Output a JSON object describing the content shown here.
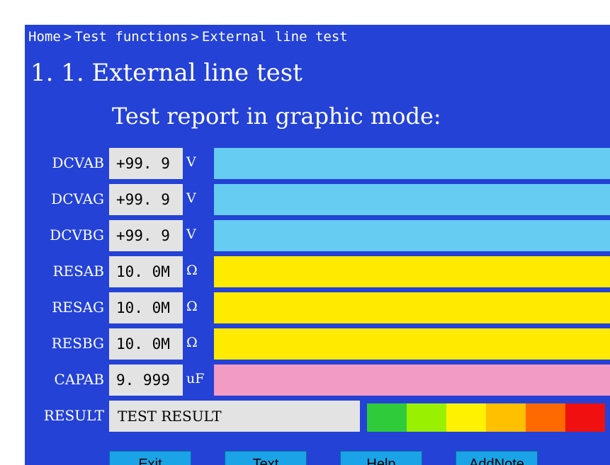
{
  "breadcrumb": {
    "items": [
      "Home",
      "Test functions",
      "External line test"
    ],
    "separator": ">"
  },
  "page": {
    "title": "1. 1. External line test",
    "subtitle": "Test report in graphic mode:"
  },
  "measurements": [
    {
      "label": "DCVAB",
      "value": "+99. 9",
      "unit": "V",
      "bar_color": "#66ccf2"
    },
    {
      "label": "DCVAG",
      "value": "+99. 9",
      "unit": "V",
      "bar_color": "#66ccf2"
    },
    {
      "label": "DCVBG",
      "value": "+99. 9",
      "unit": "V",
      "bar_color": "#66ccf2"
    },
    {
      "label": "RESAB",
      "value": "10. 0M",
      "unit": "Ω",
      "bar_color": "#ffea00"
    },
    {
      "label": "RESAG",
      "value": "10. 0M",
      "unit": "Ω",
      "bar_color": "#ffea00"
    },
    {
      "label": "RESBG",
      "value": "10. 0M",
      "unit": "Ω",
      "bar_color": "#ffea00"
    },
    {
      "label": "CAPAB",
      "value": "9. 999",
      "unit": "uF",
      "bar_color": "#f29bc4"
    }
  ],
  "result": {
    "label": "RESULT",
    "value": "TEST RESULT",
    "scale_colors": [
      "#2fcb3a",
      "#99f000",
      "#fff200",
      "#ffc000",
      "#ff6a00",
      "#f01010"
    ]
  },
  "buttons": [
    {
      "label": "Exit"
    },
    {
      "label": "Text"
    },
    {
      "label": "Help"
    },
    {
      "label": "AddNote"
    }
  ],
  "colors": {
    "background": "#2442d6",
    "field": "#e3e3e3",
    "button": "#1aa3e6"
  }
}
